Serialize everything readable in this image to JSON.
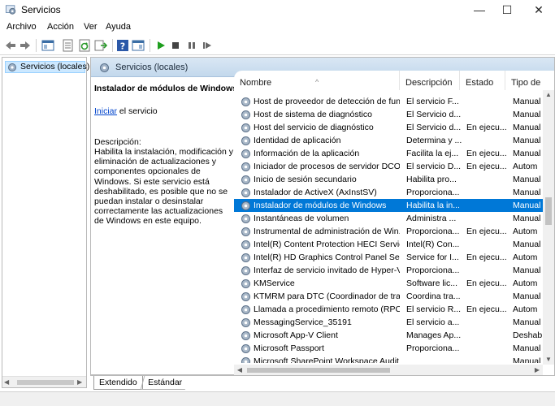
{
  "window": {
    "title": "Servicios",
    "icon": "services-gear-icon",
    "controls": [
      "—",
      "☐",
      "✕"
    ]
  },
  "menu": [
    "Archivo",
    "Acción",
    "Ver",
    "Ayuda"
  ],
  "toolbar": [
    "back-arrow-icon",
    "forward-arrow-icon",
    "console-tree-icon",
    "properties-icon",
    "refresh-icon",
    "export-icon",
    "help-icon",
    "view-icon",
    "start-service-icon",
    "stop-service-icon",
    "pause-service-icon",
    "restart-service-icon"
  ],
  "tree": {
    "selected_label": "Servicios (locales)"
  },
  "main": {
    "header": "Servicios (locales)",
    "service_title": "Instalador de módulos de Windows",
    "start_link": "Iniciar",
    "start_suffix": " el servicio",
    "description_label": "Descripción:",
    "description": "Habilita la instalación, modificación y eliminación de actualizaciones y componentes opcionales de Windows. Si este servicio está deshabilitado, es posible que no se puedan instalar o desinstalar correctamente las actualizaciones de Windows en este equipo."
  },
  "columns": [
    "Nombre",
    "Descripción",
    "Estado",
    "Tipo de"
  ],
  "rows": [
    {
      "name": "Host de proveedor de detección de fun...",
      "desc": "El servicio F...",
      "state": "",
      "type": "Manual"
    },
    {
      "name": "Host de sistema de diagnóstico",
      "desc": "El Servicio d...",
      "state": "",
      "type": "Manual"
    },
    {
      "name": "Host del servicio de diagnóstico",
      "desc": "El Servicio d...",
      "state": "En ejecu...",
      "type": "Manual"
    },
    {
      "name": "Identidad de aplicación",
      "desc": "Determina y ...",
      "state": "",
      "type": "Manual"
    },
    {
      "name": "Información de la aplicación",
      "desc": "Facilita la ej...",
      "state": "En ejecu...",
      "type": "Manual"
    },
    {
      "name": "Iniciador de procesos de servidor DCOM",
      "desc": "El servicio D...",
      "state": "En ejecu...",
      "type": "Autom"
    },
    {
      "name": "Inicio de sesión secundario",
      "desc": "Habilita pro...",
      "state": "",
      "type": "Manual"
    },
    {
      "name": "Instalador de ActiveX (AxInstSV)",
      "desc": "Proporciona...",
      "state": "",
      "type": "Manual"
    },
    {
      "name": "Instalador de módulos de Windows",
      "desc": "Habilita la in...",
      "state": "",
      "type": "Manual",
      "selected": true
    },
    {
      "name": "Instantáneas de volumen",
      "desc": "Administra ...",
      "state": "",
      "type": "Manual"
    },
    {
      "name": "Instrumental de administración de Win...",
      "desc": "Proporciona...",
      "state": "En ejecu...",
      "type": "Autom"
    },
    {
      "name": "Intel(R) Content Protection HECI Service",
      "desc": "Intel(R) Con...",
      "state": "",
      "type": "Manual"
    },
    {
      "name": "Intel(R) HD Graphics Control Panel Serv...",
      "desc": "Service for I...",
      "state": "En ejecu...",
      "type": "Autom"
    },
    {
      "name": "Interfaz de servicio invitado de Hyper-V",
      "desc": "Proporciona...",
      "state": "",
      "type": "Manual"
    },
    {
      "name": "KMService",
      "desc": "Software lic...",
      "state": "En ejecu...",
      "type": "Autom"
    },
    {
      "name": "KTMRM para DTC (Coordinador de tran...",
      "desc": "Coordina tra...",
      "state": "",
      "type": "Manual"
    },
    {
      "name": "Llamada a procedimiento remoto (RPC)",
      "desc": "El servicio R...",
      "state": "En ejecu...",
      "type": "Autom"
    },
    {
      "name": "MessagingService_35191",
      "desc": "El servicio a...",
      "state": "",
      "type": "Manual"
    },
    {
      "name": "Microsoft App-V Client",
      "desc": "Manages Ap...",
      "state": "",
      "type": "Deshab"
    },
    {
      "name": "Microsoft Passport",
      "desc": "Proporciona...",
      "state": "",
      "type": "Manual"
    },
    {
      "name": "Microsoft SharePoint Workspace Audit",
      "desc": "",
      "state": "",
      "type": "Manual"
    }
  ],
  "tabs": [
    "Extendido",
    "Estándar"
  ],
  "colors": {
    "selection": "#0078d7",
    "header_gradient": "#c3d8ec",
    "link": "#0044cc"
  }
}
